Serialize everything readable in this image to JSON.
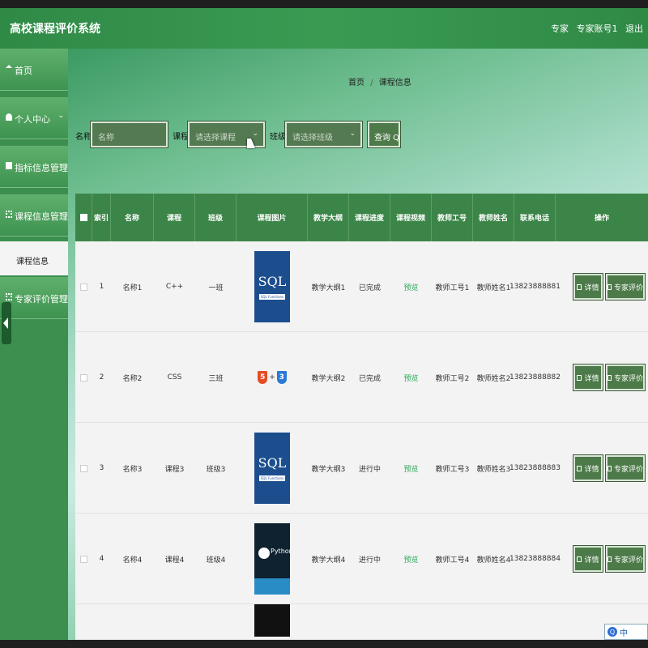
{
  "header": {
    "title": "高校课程评价系统",
    "role": "专家",
    "account": "专家账号1",
    "logout": "退出"
  },
  "sidebar": {
    "items": [
      {
        "label": "首页",
        "icon": "home-icon",
        "chevron": ""
      },
      {
        "label": "个人中心",
        "icon": "user-icon",
        "chevron": "⌄"
      },
      {
        "label": "指标信息管理",
        "icon": "bookmark-icon",
        "chevron": "⌄"
      },
      {
        "label": "课程信息管理",
        "icon": "grid-icon",
        "chevron": "⌄"
      },
      {
        "label": "专家评价管理",
        "icon": "grid-icon",
        "chevron": "⌄"
      }
    ],
    "active_sub": "课程信息"
  },
  "breadcrumb": {
    "home": "首页",
    "sep": "/",
    "current": "课程信息"
  },
  "search": {
    "name_label": "名称",
    "name_placeholder": "名称",
    "course_label": "课程",
    "course_placeholder": "请选择课程",
    "class_label": "班级",
    "class_placeholder": "请选择班级",
    "query_button": "查询 Q"
  },
  "table": {
    "headers": [
      "",
      "索引",
      "名称",
      "课程",
      "班级",
      "课程图片",
      "教学大纲",
      "课程进度",
      "课程视频",
      "教师工号",
      "教师姓名",
      "联系电话",
      "操作"
    ],
    "rows": [
      {
        "index": "1",
        "name": "名称1",
        "course": "C++",
        "class": "一班",
        "image": "sql-cover",
        "syllabus": "教学大纲1",
        "progress": "已完成",
        "video": "预览",
        "teacher_no": "教师工号1",
        "teacher_name": "教师姓名1",
        "phone": "13823888881"
      },
      {
        "index": "2",
        "name": "名称2",
        "course": "CSS",
        "class": "三班",
        "image": "html5-css3-cover",
        "syllabus": "教学大纲2",
        "progress": "已完成",
        "video": "预览",
        "teacher_no": "教师工号2",
        "teacher_name": "教师姓名2",
        "phone": "13823888882"
      },
      {
        "index": "3",
        "name": "名称3",
        "course": "课程3",
        "class": "班级3",
        "image": "sql-cover",
        "syllabus": "教学大纲3",
        "progress": "进行中",
        "video": "预览",
        "teacher_no": "教师工号3",
        "teacher_name": "教师姓名3",
        "phone": "13823888883"
      },
      {
        "index": "4",
        "name": "名称4",
        "course": "课程4",
        "class": "班级4",
        "image": "python-cover",
        "syllabus": "教学大纲4",
        "progress": "进行中",
        "video": "预览",
        "teacher_no": "教师工号4",
        "teacher_name": "教师姓名4",
        "phone": "13823888884"
      }
    ],
    "detail_button": "详情",
    "review_button": "专家评价",
    "cover_text": {
      "sql_big": "SQL",
      "sql_small": "SQL Functions",
      "html5": "5",
      "css3": "3",
      "plus": "+",
      "python": "Python"
    }
  },
  "ime": {
    "label": "中"
  },
  "colors": {
    "header": "#2f8a46",
    "sidebar": "#3c8f4f",
    "table_header": "#3c8548",
    "button": "#4d7a49",
    "video_link": "#2eaa5c"
  }
}
